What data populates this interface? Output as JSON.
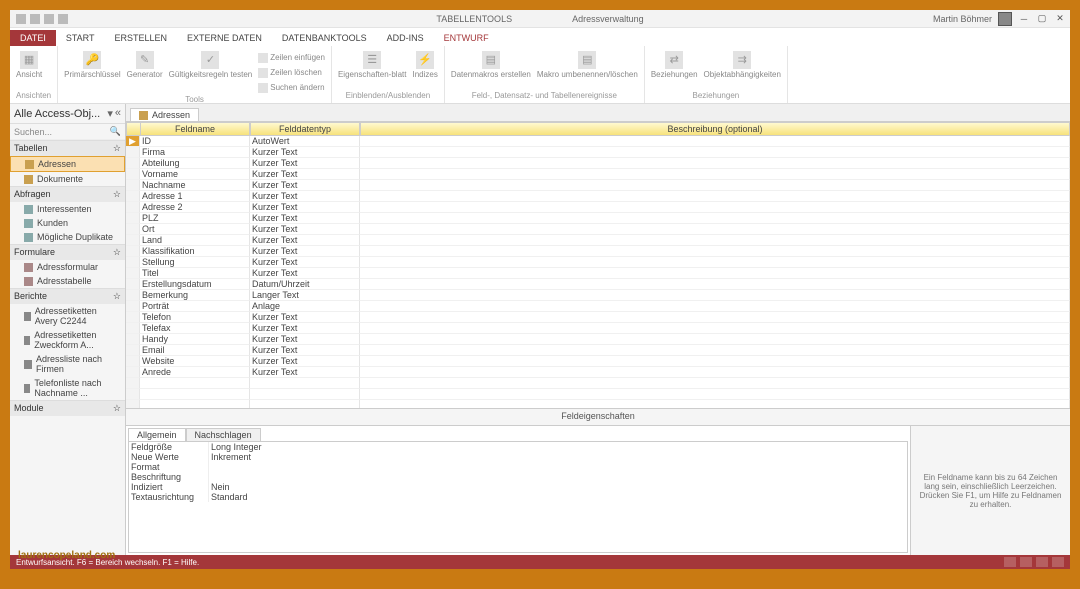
{
  "window": {
    "tool_context": "TABELLENTOOLS",
    "app_title": "Adressverwaltung",
    "user": "Martin Böhmer"
  },
  "ribbon_tabs": {
    "datei": "DATEI",
    "start": "START",
    "erstellen": "ERSTELLEN",
    "externe": "EXTERNE DATEN",
    "dbtools": "DATENBANKTOOLS",
    "addins": "ADD-INS",
    "entwurf": "ENTWURF"
  },
  "ribbon": {
    "ansicht": "Ansicht",
    "primary": "Primärschlüssel",
    "generator": "Generator",
    "gultig": "Gültigkeitsregeln testen",
    "zeilen_einfugen": "Zeilen einfügen",
    "zeilen_loschen": "Zeilen löschen",
    "suchen_andern": "Suchen ändern",
    "eigenschaften": "Eigenschaften-blatt",
    "indizes": "Indizes",
    "datenmakros": "Datenmakros erstellen",
    "makro_umb": "Makro umbenennen/löschen",
    "beziehungen": "Beziehungen",
    "objektabh": "Objektabhängigkeiten",
    "grp_ansichten": "Ansichten",
    "grp_tools": "Tools",
    "grp_einblenden": "Einblenden/Ausblenden",
    "grp_ereignisse": "Feld-, Datensatz- und Tabellenereignisse",
    "grp_beziehungen": "Beziehungen"
  },
  "nav": {
    "title": "Alle Access-Obj...",
    "search": "Suchen...",
    "groups": {
      "tabellen": "Tabellen",
      "abfragen": "Abfragen",
      "formulare": "Formulare",
      "berichte": "Berichte",
      "module": "Module"
    },
    "items": {
      "adressen": "Adressen",
      "dokumente": "Dokumente",
      "interessenten": "Interessenten",
      "kunden": "Kunden",
      "duplikate": "Mögliche Duplikate",
      "adressformular": "Adressformular",
      "adresstabelle": "Adresstabelle",
      "etiketten_avery": "Adressetiketten Avery C2244",
      "etiketten_zweck": "Adressetiketten Zweckform A...",
      "adressliste_firmen": "Adressliste nach Firmen",
      "telefonliste": "Telefonliste nach Nachname ..."
    }
  },
  "doc_tab": "Adressen",
  "grid": {
    "headers": {
      "name": "Feldname",
      "type": "Felddatentyp",
      "desc": "Beschreibung (optional)"
    },
    "rows": [
      {
        "name": "ID",
        "type": "AutoWert",
        "sel": true,
        "key": true
      },
      {
        "name": "Firma",
        "type": "Kurzer Text"
      },
      {
        "name": "Abteilung",
        "type": "Kurzer Text"
      },
      {
        "name": "Vorname",
        "type": "Kurzer Text"
      },
      {
        "name": "Nachname",
        "type": "Kurzer Text"
      },
      {
        "name": "Adresse 1",
        "type": "Kurzer Text"
      },
      {
        "name": "Adresse 2",
        "type": "Kurzer Text"
      },
      {
        "name": "PLZ",
        "type": "Kurzer Text"
      },
      {
        "name": "Ort",
        "type": "Kurzer Text"
      },
      {
        "name": "Land",
        "type": "Kurzer Text"
      },
      {
        "name": "Klassifikation",
        "type": "Kurzer Text"
      },
      {
        "name": "Stellung",
        "type": "Kurzer Text"
      },
      {
        "name": "Titel",
        "type": "Kurzer Text"
      },
      {
        "name": "Erstellungsdatum",
        "type": "Datum/Uhrzeit"
      },
      {
        "name": "Bemerkung",
        "type": "Langer Text"
      },
      {
        "name": "Porträt",
        "type": "Anlage"
      },
      {
        "name": "Telefon",
        "type": "Kurzer Text"
      },
      {
        "name": "Telefax",
        "type": "Kurzer Text"
      },
      {
        "name": "Handy",
        "type": "Kurzer Text"
      },
      {
        "name": "Email",
        "type": "Kurzer Text"
      },
      {
        "name": "Website",
        "type": "Kurzer Text"
      },
      {
        "name": "Anrede",
        "type": "Kurzer Text"
      }
    ]
  },
  "props": {
    "section_label": "Feldeigenschaften",
    "tabs": {
      "allgemein": "Allgemein",
      "nachschlagen": "Nachschlagen"
    },
    "rows": {
      "feldgrosse_l": "Feldgröße",
      "feldgrosse_v": "Long Integer",
      "neuewerte_l": "Neue Werte",
      "neuewerte_v": "Inkrement",
      "format_l": "Format",
      "format_v": "",
      "beschriftung_l": "Beschriftung",
      "beschriftung_v": "",
      "indiziert_l": "Indiziert",
      "indiziert_v": "Nein",
      "textaus_l": "Textausrichtung",
      "textaus_v": "Standard"
    },
    "hint": "Ein Feldname kann bis zu 64 Zeichen lang sein, einschließlich Leerzeichen. Drücken Sie F1, um Hilfe zu Feldnamen zu erhalten."
  },
  "status": {
    "text": "Entwurfsansicht. F6 = Bereich wechseln. F1 = Hilfe."
  },
  "watermark": "laurencopeland.com"
}
